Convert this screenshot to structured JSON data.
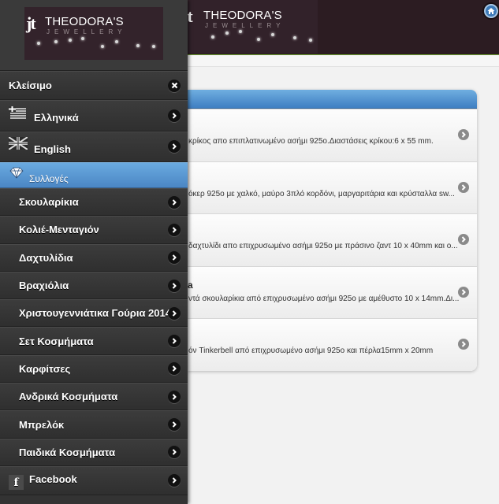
{
  "brand": {
    "name": "THEODORA'S",
    "subtitle": "JEWELLERY",
    "monogram": "jt"
  },
  "header": {
    "home_icon": "home-icon"
  },
  "panel": {
    "close": {
      "label": "Κλείσιμο",
      "icon": "close-icon"
    },
    "languages": [
      {
        "label": "Ελληνικά",
        "icon": "greek-flag-icon"
      },
      {
        "label": "English",
        "icon": "uk-flag-icon"
      }
    ],
    "collections": {
      "label": "Συλλογές",
      "icon": "diamond-icon"
    },
    "categories": [
      {
        "label": "Σκουλαρίκια"
      },
      {
        "label": "Κολιέ-Μενταγιόν"
      },
      {
        "label": "Δαχτυλίδια"
      },
      {
        "label": "Βραχιόλια"
      },
      {
        "label": "Χριστουγεννιάτικα Γούρια 2014"
      },
      {
        "label": "Σετ Κοσμήματα"
      },
      {
        "label": "Καρφίτσες"
      },
      {
        "label": "Ανδρικά Κοσμήματα"
      },
      {
        "label": "Μπρελόκ"
      },
      {
        "label": "Παιδικά Κοσμήματα"
      }
    ],
    "facebook": {
      "label": "Facebook",
      "icon": "facebook-icon"
    }
  },
  "products": [
    {
      "title": "",
      "description": "κρίκος απο επιπλατινωμένο ασήμι 925ο.Διαστάσεις κρίκου:6 x 55 mm."
    },
    {
      "title": "",
      "description": "όκερ 925ο με χαλκό, μαύρο 3πλό κορδόνι, μαργαριτάρια και κρύσταλλα sw..."
    },
    {
      "title": "",
      "description": "δαχτυλίδι απο επιχρυσωμένο ασήμι 925ο με πράσινο ζαντ 10 x 40mm και ο..."
    },
    {
      "title": "a",
      "description": "ντά σκουλαρίκια από επιχρυσωμένο ασήμι 925ο με αμέθυστο 10 x 14mm.Δι..."
    },
    {
      "title": "",
      "description": "όν Tinkerbell από επιχρυσωμένο ασήμι 925ο και πέρλα15mm x 20mm"
    }
  ],
  "colors": {
    "header_bg": "#2c1c22",
    "panel_bg": "#333333",
    "accent_blue": "#4b86c4",
    "page_bg": "#f2f2f2"
  }
}
